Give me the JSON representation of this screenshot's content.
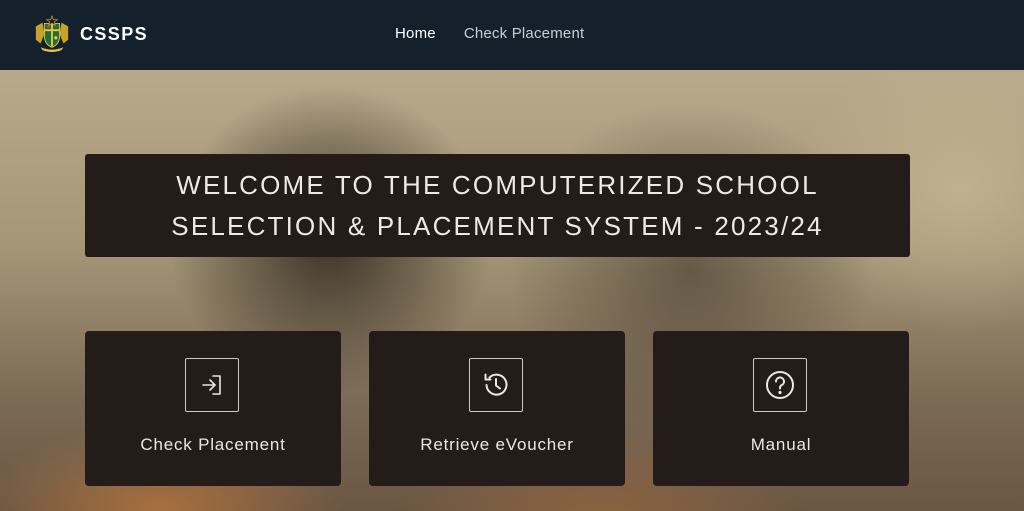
{
  "brand": {
    "name": "CSSPS",
    "logo_icon": "ghana-coat-of-arms-icon"
  },
  "nav": {
    "items": [
      {
        "label": "Home",
        "active": true
      },
      {
        "label": "Check Placement",
        "active": false
      }
    ]
  },
  "welcome": {
    "line1": "WELCOME TO THE COMPUTERIZED SCHOOL",
    "line2": "SELECTION & PLACEMENT SYSTEM - 2023/24"
  },
  "cards": [
    {
      "label": "Check Placement",
      "icon": "sign-in-icon"
    },
    {
      "label": "Retrieve eVoucher",
      "icon": "history-icon"
    },
    {
      "label": "Manual",
      "icon": "help-circle-icon"
    }
  ],
  "colors": {
    "navbar": "#14202b",
    "panel": "#231c19",
    "text_light": "#efe9e2"
  }
}
